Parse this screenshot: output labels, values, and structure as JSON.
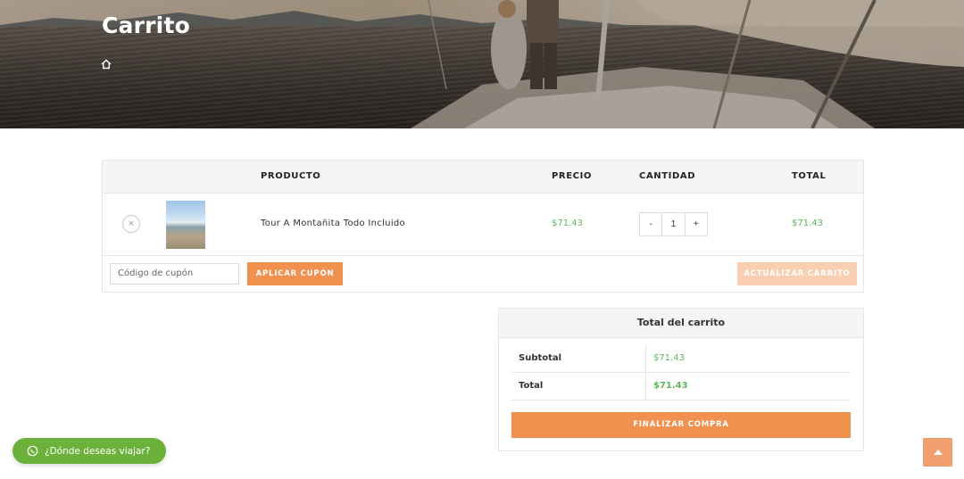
{
  "hero": {
    "title": "Carrito",
    "breadcrumb_icon": "home-icon"
  },
  "cart": {
    "columns": {
      "product": "PRODUCTO",
      "price": "PRECIO",
      "quantity": "CANTIDAD",
      "total": "TOTAL"
    },
    "items": [
      {
        "remove_icon": "×",
        "name": "Tour A Montañita Todo Incluido",
        "price": "$71.43",
        "quantity": "1",
        "minus": "-",
        "plus": "+",
        "total": "$71.43"
      }
    ],
    "coupon_placeholder": "Código de cupón",
    "apply_coupon_label": "APLICAR CUPÓN",
    "update_cart_label": "ACTUALIZAR CARRITO"
  },
  "totals": {
    "heading": "Total del carrito",
    "subtotal_label": "Subtotal",
    "subtotal_value": "$71.43",
    "total_label": "Total",
    "total_value": "$71.43",
    "checkout_label": "FINALIZAR COMPRA"
  },
  "whatsapp": {
    "label": "¿Dónde deseas viajar?",
    "icon": "whatsapp-icon"
  },
  "colors": {
    "accent": "#f0914f",
    "accent_disabled": "#f8cfb0",
    "price_green": "#5cb85c",
    "whatsapp_green": "#6cb13a"
  }
}
